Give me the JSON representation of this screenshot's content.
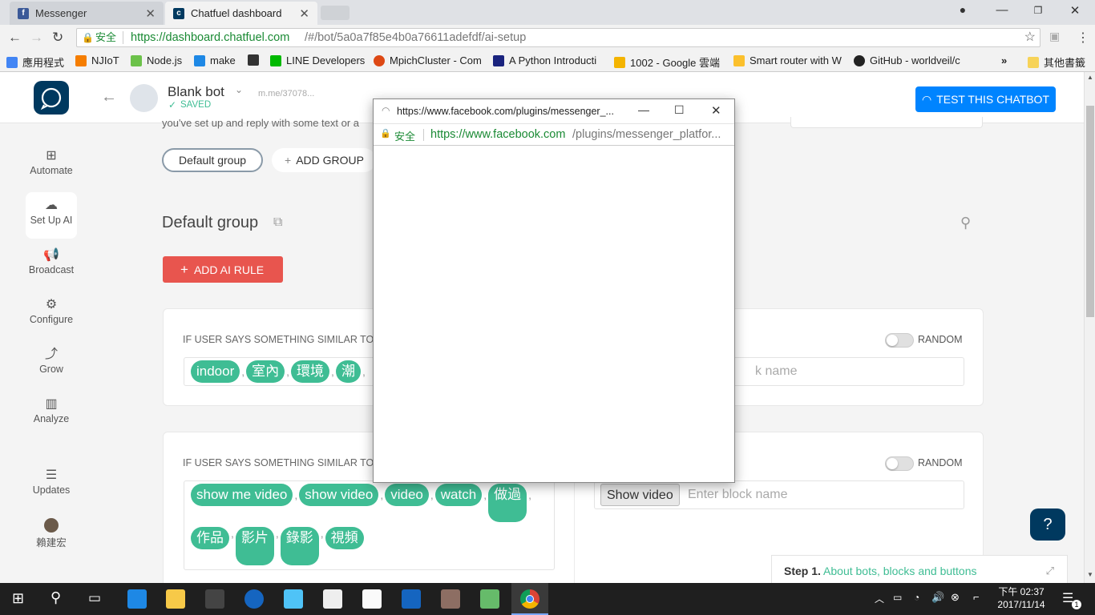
{
  "browser": {
    "tabs": [
      {
        "label": "Messenger",
        "icon": "facebook-icon",
        "active": false
      },
      {
        "label": "Chatfuel dashboard",
        "icon": "chatfuel-icon",
        "active": true
      }
    ],
    "secure_label": "安全",
    "url_host": "https://dashboard.chatfuel.com",
    "url_path": "/#/bot/5a0a7f85e4b0a76611adefdf/ai-setup",
    "bookmarks": [
      {
        "label": "應用程式",
        "icon": "apps-grid-icon",
        "color": "#4285f4"
      },
      {
        "label": "NJIoT",
        "icon": "blogger-icon",
        "color": "#f57d00"
      },
      {
        "label": "Node.js",
        "icon": "nodejs-icon",
        "color": "#6cc24a"
      },
      {
        "label": "make",
        "icon": "make-icon",
        "color": "#1e88e5"
      },
      {
        "label": "",
        "icon": "github-cat-icon",
        "color": "#333333"
      },
      {
        "label": "LINE Developers",
        "icon": "line-icon",
        "color": "#00b900"
      },
      {
        "label": "MpichCluster - Com",
        "icon": "ubuntu-icon",
        "color": "#dd4814"
      },
      {
        "label": "A Python Introducti",
        "icon": "grid-icon",
        "color": "#1a237e"
      },
      {
        "label": "1002 - Google 雲端",
        "icon": "gdrive-icon",
        "color": "#f4b400"
      },
      {
        "label": "Smart router with W",
        "icon": "instructables-icon",
        "color": "#fbc02d"
      },
      {
        "label": "GitHub - worldveil/c",
        "icon": "github-icon",
        "color": "#222222"
      }
    ],
    "bookmarks_more": "»",
    "other_bookmarks": "其他書籤"
  },
  "app": {
    "bot_name": "Blank bot",
    "saved": "SAVED",
    "me_link": "m.me/37078...",
    "test_button": "TEST THIS CHATBOT",
    "sidebar": [
      {
        "label": "Automate",
        "icon": "automate-icon"
      },
      {
        "label": "Set Up AI",
        "icon": "ai-icon",
        "selected": true
      },
      {
        "label": "Broadcast",
        "icon": "megaphone-icon"
      },
      {
        "label": "Configure",
        "icon": "gear-icon"
      },
      {
        "label": "Grow",
        "icon": "grow-icon"
      },
      {
        "label": "Analyze",
        "icon": "bar-chart-icon"
      },
      {
        "label": "Updates",
        "icon": "updates-icon"
      },
      {
        "label": "賴建宏",
        "icon": "avatar"
      }
    ],
    "intro_text": "you've set up and reply with some text or a",
    "group_tab": "Default group",
    "add_group": "ADD GROUP",
    "group_title": "Default group",
    "add_rule": "ADD AI RULE",
    "rule_label": "IF USER SAYS SOMETHING SIMILAR TO:",
    "random_label": "RANDOM",
    "rule1_keywords": [
      "indoor",
      "室內",
      "環境",
      "潮"
    ],
    "rule1_placeholder": "k name",
    "rule2_keywords_row1": [
      "show me video",
      "show video",
      "video",
      "watch",
      "做過"
    ],
    "rule2_keywords_row2": [
      "作品",
      "影片",
      "錄影",
      "視頻"
    ],
    "rule2_block": "Show video",
    "rule2_placeholder": "Enter block name",
    "step_prefix": "Step 1.",
    "step_link": "About bots, blocks and buttons",
    "accent": "#0084ff",
    "green": "#3fbd94",
    "red": "#e8554e"
  },
  "popup": {
    "title": "https://www.facebook.com/plugins/messenger_...",
    "secure_label": "安全",
    "url_host": "https://www.facebook.com",
    "url_path": "/plugins/messenger_platfor..."
  },
  "taskbar": {
    "time": "下午 02:37",
    "date": "2017/11/14",
    "notif_count": "1"
  }
}
